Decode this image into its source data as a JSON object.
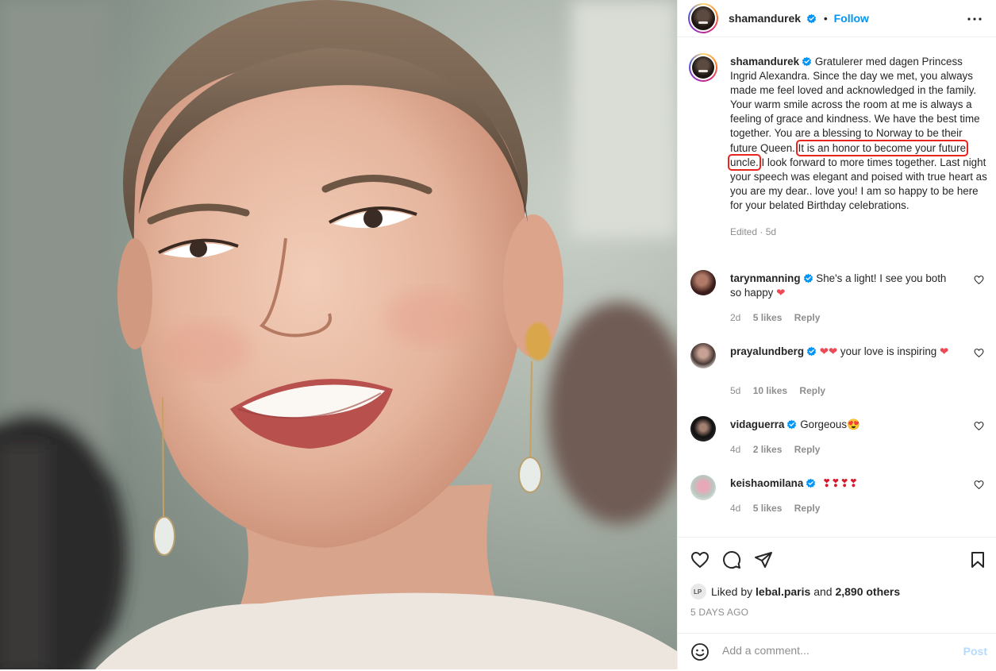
{
  "header": {
    "username": "shamandurek",
    "separator": "•",
    "follow_label": "Follow"
  },
  "caption": {
    "username": "shamandurek",
    "text_before": "Gratulerer med dagen Princess Ingrid Alexandra. Since the day we met, you always made me feel loved and acknowledged in the family. Your warm smile across the room at me is always a feeling of grace and kindness. We have the best time together. You are a blessing to Norway to be their future Queen.",
    "highlight": "It is an honor to become your future uncle.",
    "text_after": " I look forward to more times together. Last night your speech was elegant and poised with true heart as you are my dear.. love you! I am so happy to be here for your belated Birthday celebrations.",
    "edited": "Edited · 5d"
  },
  "comments": [
    {
      "username": "tarynmanning",
      "text": "She's a light! I see you both so happy",
      "emoji": "❤",
      "time": "2d",
      "likes": "5 likes",
      "reply": "Reply"
    },
    {
      "username": "prayalundberg",
      "text_prefix": "❤❤",
      "text": " your love is inspiring",
      "emoji": "❤",
      "time": "5d",
      "likes": "10 likes",
      "reply": "Reply"
    },
    {
      "username": "vidaguerra",
      "text": "Gorgeous",
      "emoji": "😍",
      "time": "4d",
      "likes": "2 likes",
      "reply": "Reply"
    },
    {
      "username": "keishaomilana",
      "text": "❣❣❣❣",
      "time": "4d",
      "likes": "5 likes",
      "reply": "Reply"
    }
  ],
  "actions": {
    "liked_by_prefix": "Liked by ",
    "liked_by_user": "lebal.paris",
    "liked_by_and": " and ",
    "liked_by_others": "2,890 others",
    "timestamp": "5 DAYS AGO"
  },
  "add_comment": {
    "placeholder": "Add a comment...",
    "post_label": "Post"
  },
  "colors": {
    "accent": "#0095f6",
    "highlight_box": "#e8251f",
    "heart": "#ed4956"
  },
  "icons": [
    "more-options-icon",
    "verified-badge-icon",
    "heart-icon",
    "comment-icon",
    "share-icon",
    "bookmark-icon",
    "emoji-icon"
  ]
}
